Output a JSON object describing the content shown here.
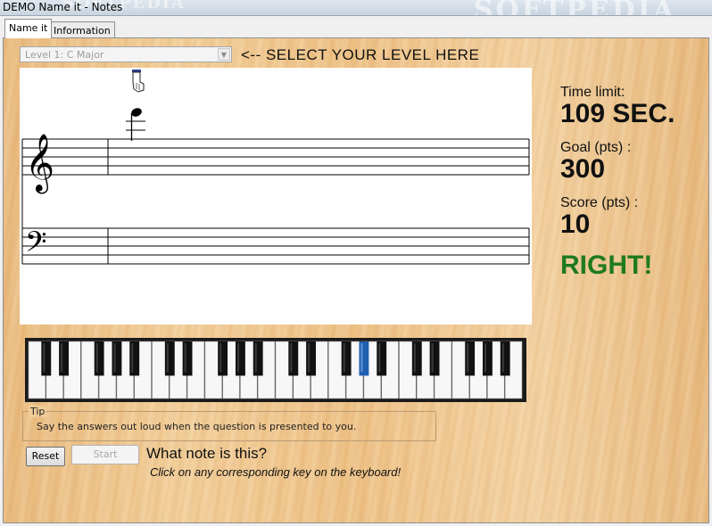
{
  "window": {
    "title": "DEMO Name it - Notes",
    "watermark": "SOFTPEDIA"
  },
  "tabs": [
    {
      "label": "Name it",
      "active": true
    },
    {
      "label": "Information",
      "active": false
    }
  ],
  "level": {
    "selected": "Level 1: C Major",
    "hint": "<-- SELECT YOUR LEVEL HERE"
  },
  "staff": {
    "clefs": [
      "treble-clef-icon",
      "bass-clef-icon"
    ],
    "note": "C6 (2 ledger lines above treble staff)"
  },
  "stats": {
    "time_label": "Time limit:",
    "time_value": "109 SEC.",
    "goal_label": "Goal (pts) :",
    "goal_value": "300",
    "score_label": "Score (pts) :",
    "score_value": "10"
  },
  "feedback": {
    "text": "RIGHT!",
    "color": "#1f7a1f"
  },
  "keyboard": {
    "white_keys": 28,
    "highlighted_black_key": 13,
    "highlight_color": "#1f5fb0"
  },
  "tip": {
    "legend": "Tip",
    "text": "Say the answers out loud when the question is presented to you."
  },
  "buttons": {
    "reset": "Reset",
    "start": "Start"
  },
  "question": {
    "text": "What note is this?",
    "instruction": "Click on any corresponding key on the keyboard!"
  }
}
